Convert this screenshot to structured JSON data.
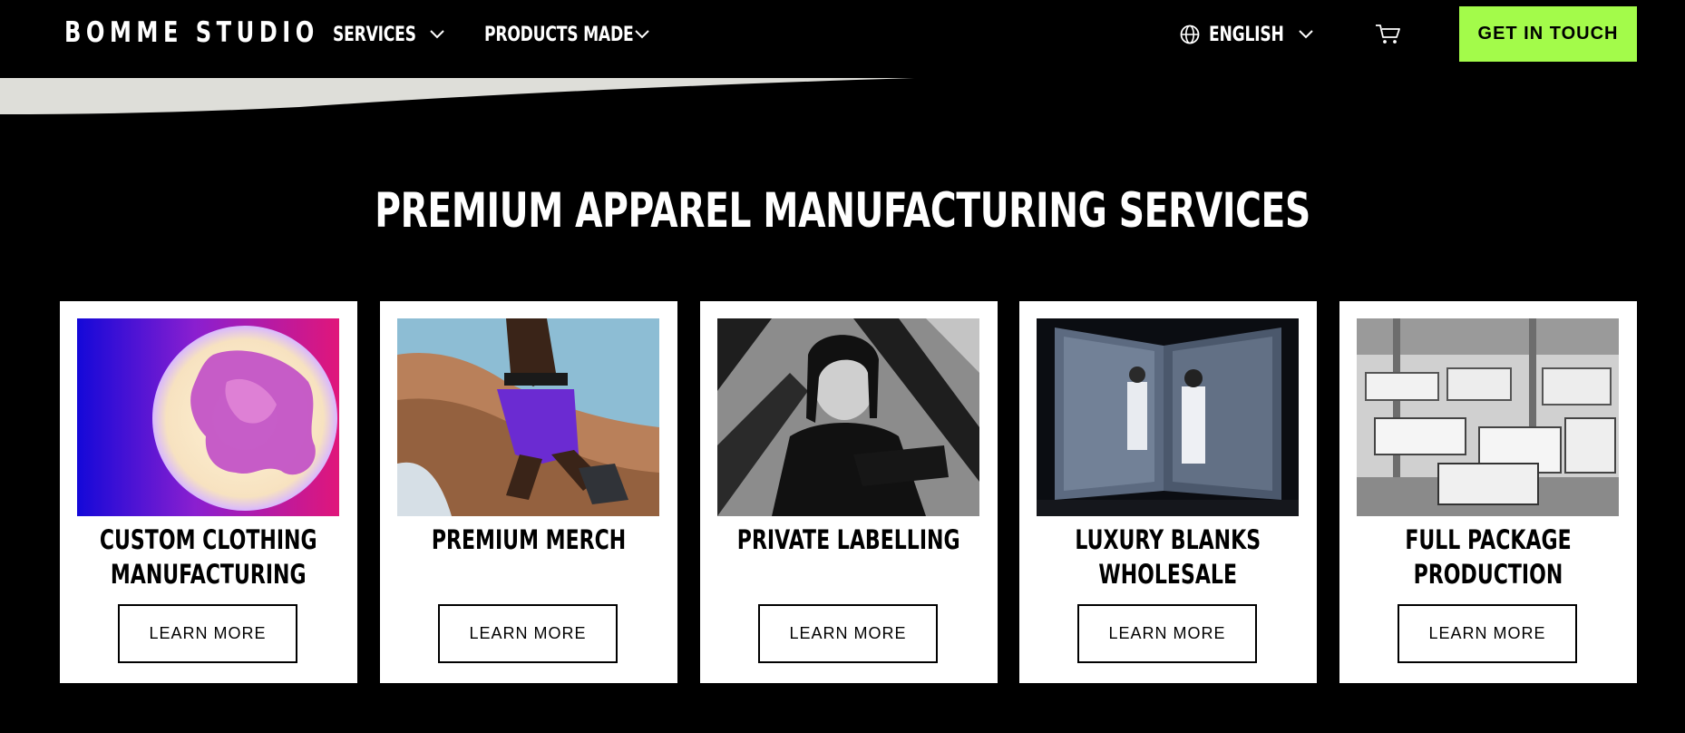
{
  "brand": {
    "logo_text": "BOMME STUDIO"
  },
  "nav": {
    "items": [
      {
        "label": "SERVICES"
      },
      {
        "label": "PRODUCTS MADE"
      }
    ],
    "language": {
      "label": "ENGLISH"
    },
    "cta_label": "GET IN TOUCH"
  },
  "colors": {
    "background": "#000000",
    "accent": "#a3fb4a",
    "card": "#ffffff",
    "swoosh": "#deded9"
  },
  "icons": [
    "chevron-down-icon",
    "globe-icon",
    "cart-icon"
  ],
  "section": {
    "title": "PREMIUM APPAREL MANUFACTURING SERVICES",
    "cards": [
      {
        "title": "CUSTOM CLOTHING\nMANUFACTURING",
        "button": "LEARN MORE"
      },
      {
        "title": "PREMIUM MERCH",
        "button": "LEARN MORE"
      },
      {
        "title": "PRIVATE LABELLING",
        "button": "LEARN MORE"
      },
      {
        "title": "LUXURY BLANKS\nWHOLESALE",
        "button": "LEARN MORE"
      },
      {
        "title": "FULL PACKAGE PRODUCTION",
        "button": "LEARN MORE"
      }
    ]
  }
}
